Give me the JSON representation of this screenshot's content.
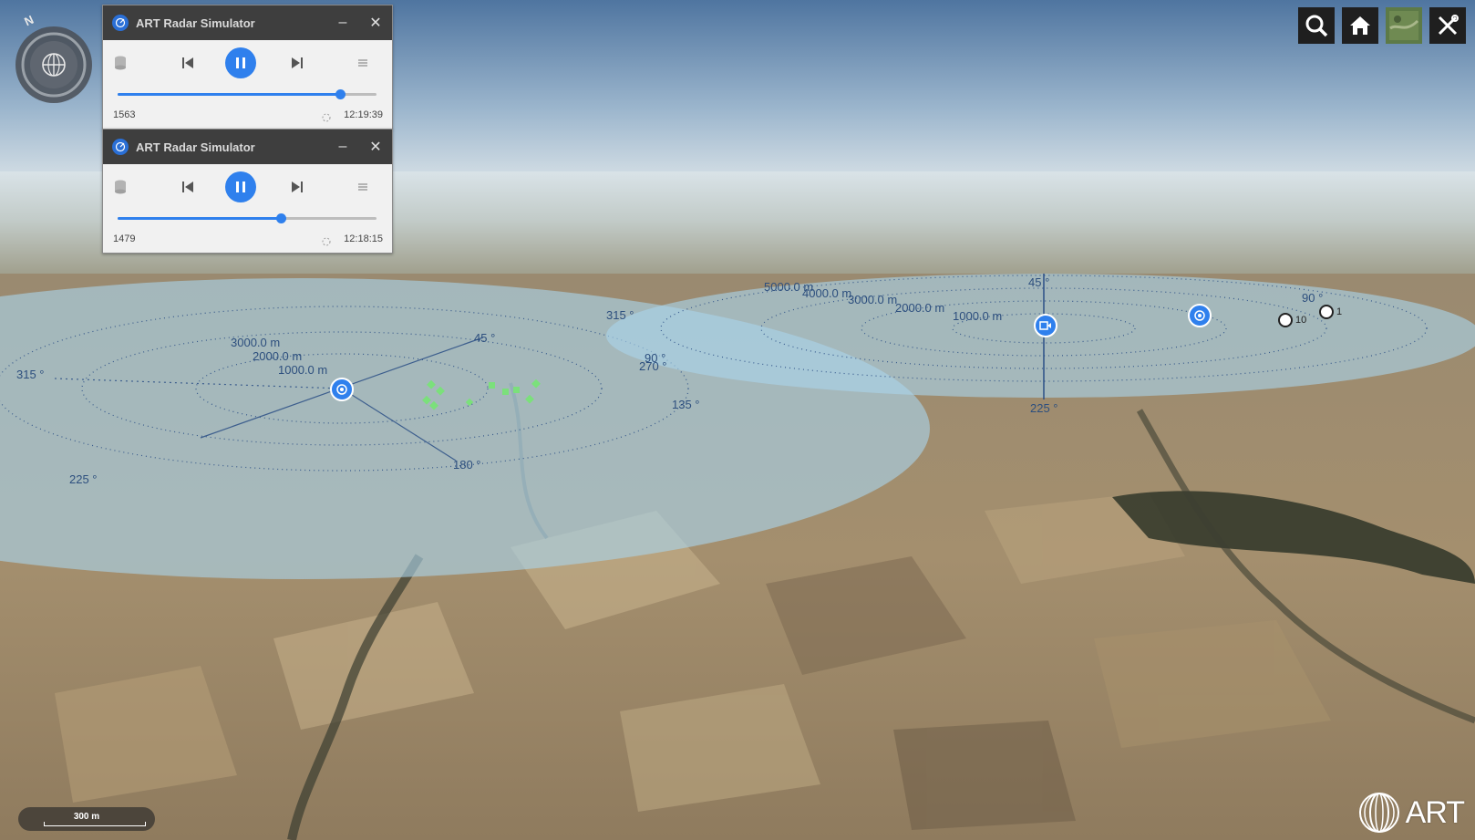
{
  "colors": {
    "accent": "#2f80ed",
    "titlebar": "#3e3e3e",
    "radar_fill": "#a9d3ea",
    "track_marker": "#7be07b",
    "range_line": "#2b4f86"
  },
  "simulators": [
    {
      "title": "ART Radar Simulator",
      "frame": "1563",
      "time": "12:19:39",
      "progress": 0.86
    },
    {
      "title": "ART Radar Simulator",
      "frame": "1479",
      "time": "12:18:15",
      "progress": 0.63
    }
  ],
  "compass": {
    "north_label": "N",
    "icon": "globe-icon"
  },
  "toolbar": {
    "buttons": [
      {
        "name": "search",
        "icon": "search-icon"
      },
      {
        "name": "home",
        "icon": "home-icon"
      },
      {
        "name": "layers",
        "icon": "map-layer-icon"
      },
      {
        "name": "tools",
        "icon": "tools-icon"
      }
    ]
  },
  "radar1": {
    "ranges": [
      "3000.0 m",
      "2000.0 m",
      "1000.0 m"
    ],
    "bearings": [
      "315 °",
      "45 °",
      "90 °",
      "135 °",
      "180 °",
      "225 °",
      "270 °"
    ]
  },
  "radar2": {
    "ranges": [
      "5000.0 m",
      "4000.0 m",
      "3000.0 m",
      "2000.0 m",
      "1000.0 m"
    ],
    "bearings": [
      "315 °",
      "45 °",
      "90 °",
      "225 °"
    ]
  },
  "targets": [
    {
      "label": "10"
    },
    {
      "label": "1"
    }
  ],
  "scale_bar": {
    "label": "300 m"
  },
  "logo": {
    "text": "ART"
  }
}
